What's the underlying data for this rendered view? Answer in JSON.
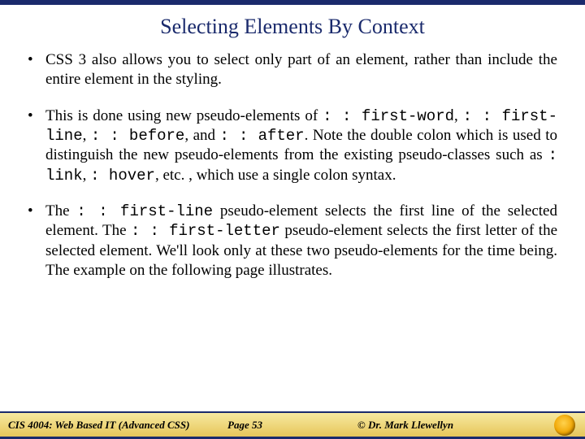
{
  "title": "Selecting Elements By Context",
  "bullets": [
    {
      "parts": [
        {
          "t": "CSS 3 also allows you to select only part of an element, rather than include the entire element in the styling."
        }
      ]
    },
    {
      "parts": [
        {
          "t": "This is done using new pseudo-elements of "
        },
        {
          "t": ": : first-word",
          "code": true
        },
        {
          "t": ", "
        },
        {
          "t": ": : first-line",
          "code": true
        },
        {
          "t": ", "
        },
        {
          "t": ": : before",
          "code": true
        },
        {
          "t": ", and "
        },
        {
          "t": ": : after",
          "code": true
        },
        {
          "t": ".  Note the double colon which is used to distinguish the new pseudo-elements from the existing pseudo-classes such as "
        },
        {
          "t": ": link",
          "code": true
        },
        {
          "t": ", "
        },
        {
          "t": ": hover",
          "code": true
        },
        {
          "t": ", etc. , which use a single colon syntax."
        }
      ]
    },
    {
      "parts": [
        {
          "t": "The "
        },
        {
          "t": ": : first-line",
          "code": true
        },
        {
          "t": " pseudo-element selects the first line of the selected element.   The "
        },
        {
          "t": ": : first-letter",
          "code": true
        },
        {
          "t": " pseudo-element selects the first letter of the selected element.  We'll  look only at these two pseudo-elements for the time being.  The example on the following page illustrates."
        }
      ]
    }
  ],
  "footer": {
    "left": "CIS 4004: Web Based IT (Advanced CSS)",
    "mid": "Page 53",
    "right": "© Dr. Mark Llewellyn"
  }
}
